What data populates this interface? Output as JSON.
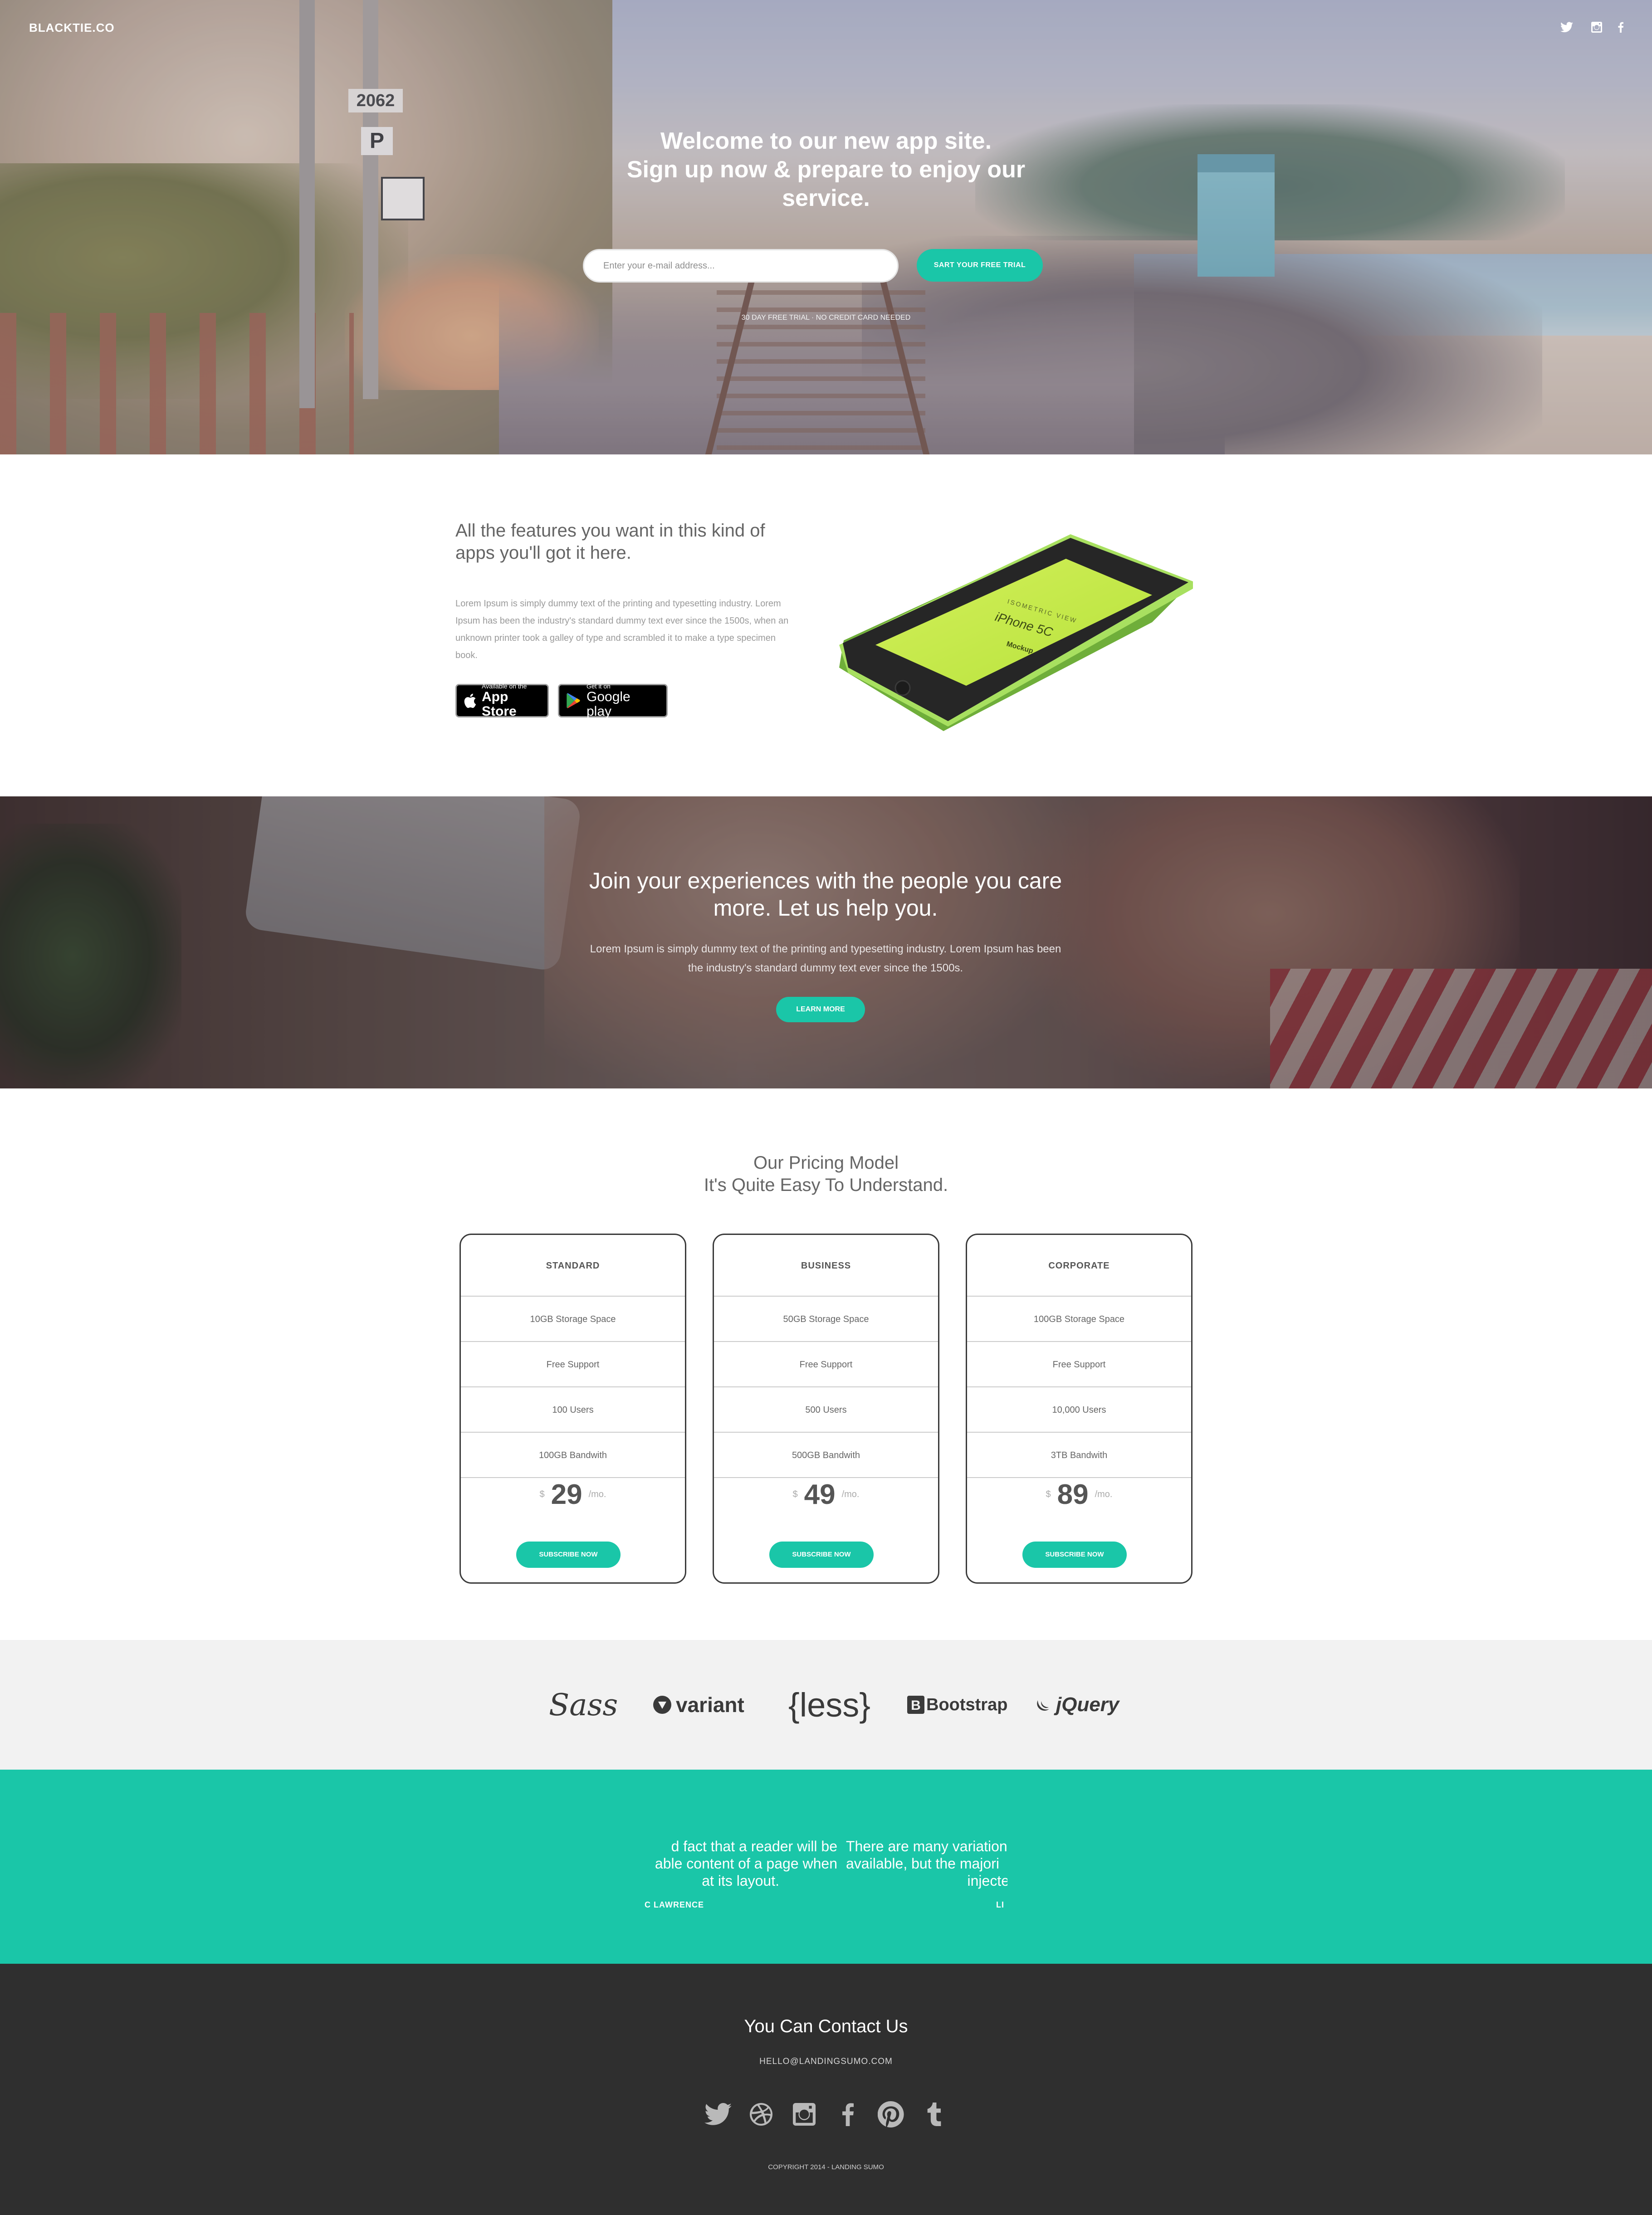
{
  "header": {
    "logo": "BLACKTIE.CO",
    "social_icons": [
      "twitter-icon",
      "instagram-icon",
      "facebook-icon"
    ]
  },
  "hero": {
    "title_lines": [
      "Welcome to our new app site.",
      "Sign up now & prepare to enjoy our",
      "service."
    ],
    "email_placeholder": "Enter your e-mail address...",
    "cta_label": "SART YOUR FREE TRIAL",
    "note": "30 DAY FREE TRIAL · NO CREDIT CARD NEEDED"
  },
  "features": {
    "title": "All the features you want in this kind of apps you'll got it here.",
    "text": "Lorem Ipsum is simply dummy text of the printing and typesetting industry. Lorem Ipsum has been the industry's standard dummy text ever since the 1500s, when an unknown printer took a galley of type and scrambled it to make a type specimen book.",
    "app_store": {
      "small": "Available on the",
      "big": "App Store"
    },
    "google_play": {
      "small": "Get it on",
      "big": "Google play"
    },
    "phone_mockup": {
      "line1": "ISOMETRIC VIEW",
      "line2": "iPhone 5C",
      "line3": "Mockup"
    }
  },
  "join": {
    "title": "Join your experiences with the people you care more. Let us help you.",
    "text": "Lorem Ipsum is simply dummy text of the printing and typesetting industry. Lorem Ipsum has been the industry's standard dummy text ever since the 1500s.",
    "button": "LEARN MORE"
  },
  "pricing": {
    "title_lines": [
      "Our Pricing Model",
      "It's Quite Easy To Understand."
    ],
    "currency": "$",
    "period": "/mo.",
    "button": "SUBSCRIBE NOW",
    "plans": [
      {
        "name": "STANDARD",
        "features": [
          "10GB Storage Space",
          "Free Support",
          "100 Users",
          "100GB Bandwith"
        ],
        "price": "29"
      },
      {
        "name": "BUSINESS",
        "features": [
          "50GB Storage Space",
          "Free Support",
          "500 Users",
          "500GB Bandwith"
        ],
        "price": "49"
      },
      {
        "name": "CORPORATE",
        "features": [
          "100GB Storage Space",
          "Free Support",
          "10,000 Users",
          "3TB Bandwith"
        ],
        "price": "89"
      }
    ]
  },
  "logos": [
    "Sass",
    "variant",
    "{less}",
    "Bootstrap",
    "jQuery"
  ],
  "testimonials": [
    {
      "quote_lines": [
        "d fact that a reader will be",
        "able content of a page when",
        "at its layout."
      ],
      "author": "C LAWRENCE"
    },
    {
      "quote_lines": [
        "There are many variation",
        "available, but the majori",
        "injecte"
      ],
      "author": "LI"
    }
  ],
  "footer": {
    "title": "You Can Contact Us",
    "email": "HELLO@LANDINGSUMO.COM",
    "social_icons": [
      "twitter-icon",
      "dribbble-icon",
      "instagram-icon",
      "facebook-icon",
      "pinterest-icon",
      "tumblr-icon"
    ],
    "copyright": "COPYRIGHT 2014 - LANDING SUMO"
  },
  "colors": {
    "accent": "#1ac6a8",
    "footer_bg": "#2f2f2f",
    "logos_bg": "#f2f2f2"
  }
}
